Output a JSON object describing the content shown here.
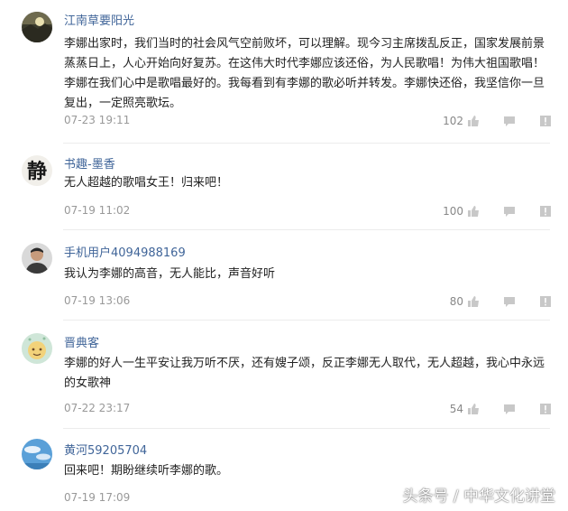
{
  "comments": [
    {
      "username": "江南草要阳光",
      "avatar": "avatar-sunset-landscape",
      "content": "李娜出家时，我们当时的社会风气空前败坏，可以理解。现今习主席拨乱反正，国家发展前景蒸蒸日上，人心开始向好复苏。在这伟大时代李娜应该还俗，为人民歌唱！为伟大祖国歌唱！李娜在我们心中是歌唱最好的。我每看到有李娜的歌必听并转发。李娜快还俗，我坚信你一旦复出，一定照亮歌坛。",
      "time": "07-23 19:11",
      "likes": "102"
    },
    {
      "username": "书趣-墨香",
      "avatar": "avatar-calligraphy-jing",
      "avatar_char": "静",
      "content": "无人超越的歌唱女王！归来吧！",
      "time": "07-19 11:02",
      "likes": "100"
    },
    {
      "username": "手机用户4094988169",
      "avatar": "avatar-person-portrait",
      "content": "我认为李娜的高音，无人能比，声音好听",
      "time": "07-19 13:06",
      "likes": "80"
    },
    {
      "username": "晋典客",
      "avatar": "avatar-cartoon-face",
      "content": "李娜的好人一生平安让我万听不厌，还有嫂子颂，反正李娜无人取代，无人超越，我心中永远的女歌神",
      "time": "07-22 23:17",
      "likes": "54"
    },
    {
      "username": "黄河59205704",
      "avatar": "avatar-blue-sky",
      "content": "回来吧！期盼继续听李娜的歌。",
      "time": "07-19 17:09",
      "likes": ""
    }
  ],
  "icons": [
    "thumbs-up-icon",
    "reply-icon",
    "report-icon"
  ],
  "colors": {
    "username": "#406599",
    "text": "#222222",
    "meta": "#999999",
    "icon": "#c8c8c8",
    "divider": "#ececec"
  },
  "watermark": "头条号 / 中华文化讲堂"
}
